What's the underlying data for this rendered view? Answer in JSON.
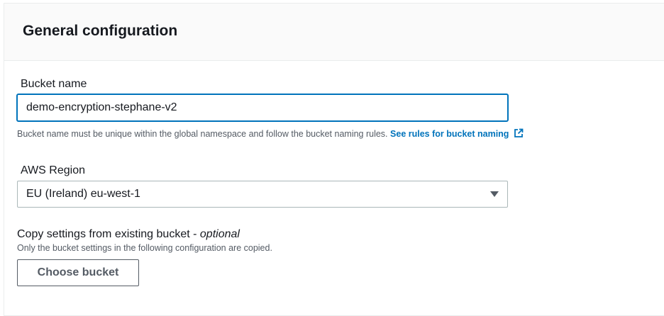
{
  "panel": {
    "title": "General configuration"
  },
  "bucket_name": {
    "label": "Bucket name",
    "value": "demo-encryption-stephane-v2",
    "hint": "Bucket name must be unique within the global namespace and follow the bucket naming rules.",
    "link_label": "See rules for bucket naming",
    "link_icon": "external-link-icon"
  },
  "region": {
    "label": "AWS Region",
    "selected": "EU (Ireland) eu-west-1",
    "caret_icon": "caret-down-icon"
  },
  "copy_settings": {
    "label": "Copy settings from existing bucket - ",
    "label_optional": "optional",
    "description": "Only the bucket settings in the following configuration are copied.",
    "button_label": "Choose bucket"
  },
  "colors": {
    "link": "#0073bb",
    "focus_border": "#0073bb",
    "text": "#16191f",
    "muted": "#545b64"
  }
}
